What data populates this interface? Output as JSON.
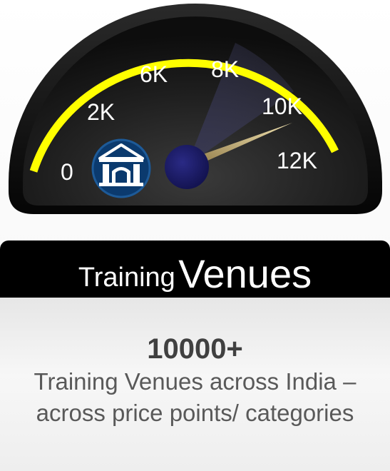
{
  "gauge": {
    "tick_labels": [
      "0",
      "2K",
      "6K",
      "8K",
      "10K",
      "12K"
    ],
    "accent_color": "#ffff00",
    "hub_color": "#1b1b6b",
    "needle_color": "#d8c48a",
    "icon": "venue-building-icon"
  },
  "banner": {
    "small_word": "Training",
    "big_word": "Venues"
  },
  "info": {
    "count": "10000+",
    "description": "Training Venues across India – across price points/ categories"
  }
}
